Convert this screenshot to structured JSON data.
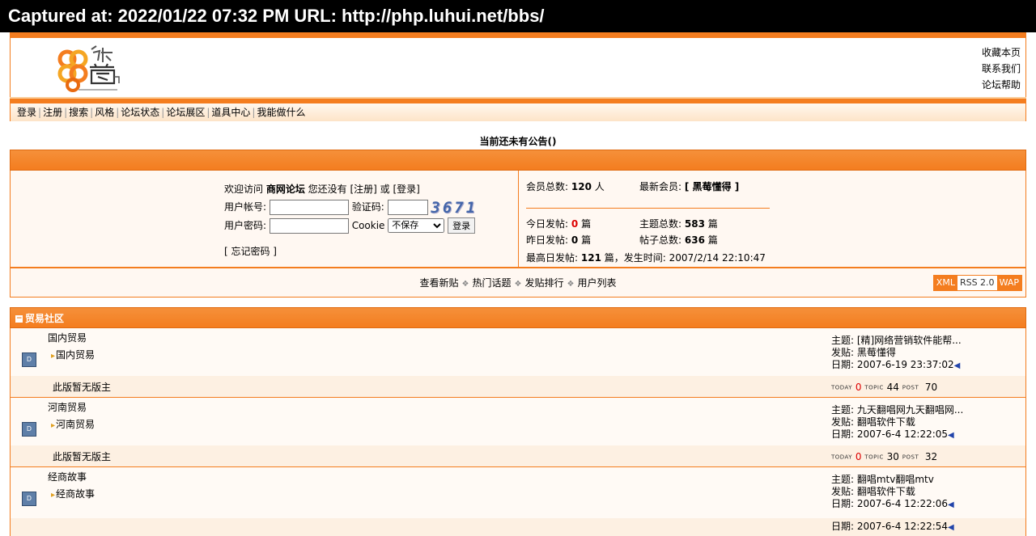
{
  "capture": {
    "label": "Captured at: 2022/01/22 07:32 PM    URL: http://php.luhui.net/bbs/"
  },
  "header": {
    "links": [
      "收藏本页",
      "联系我们",
      "论坛帮助"
    ]
  },
  "nav": {
    "items": [
      "登录",
      "注册",
      "搜索",
      "风格",
      "论坛状态",
      "论坛展区",
      "道具中心",
      "我能做什么"
    ]
  },
  "announcement": "当前还未有公告()",
  "login": {
    "welcome_pre": "欢迎访问 ",
    "forum_name": "商网论坛",
    "welcome_mid": " 您还没有 [注册] 或 [登录]",
    "account_label": "用户帐号:",
    "code_label": "验证码:",
    "captcha": "3671",
    "password_label": "用户密码:",
    "cookie_label": "Cookie",
    "cookie_option": "不保存",
    "login_button": "登录",
    "forgot": "[ 忘记密码 ]"
  },
  "stats": {
    "members_label": "会员总数:",
    "members_value": "120",
    "members_unit": "人",
    "newest_label": "最新会员:",
    "newest_value": "[ 黑莓懂得 ]",
    "today_label": "今日发帖:",
    "today_value": "0",
    "unit_pian": "篇",
    "topics_label": "主题总数:",
    "topics_value": "583",
    "yesterday_label": "昨日发帖:",
    "yesterday_value": "0",
    "posts_label": "帖子总数:",
    "posts_value": "636",
    "max_label": "最高日发帖:",
    "max_value": "121",
    "max_unit": "篇，发生时间:",
    "max_time": "2007/2/14 22:10:47"
  },
  "links_bar": {
    "items": [
      "查看新贴",
      "热门话题",
      "发贴排行",
      "用户列表"
    ],
    "badges": [
      "XML",
      "RSS 2.0",
      "WAP"
    ]
  },
  "section": {
    "title": "贸易社区"
  },
  "forums": [
    {
      "name": "国内贸易",
      "sub": "国内贸易",
      "mods": "此版暂无版主",
      "last_topic": "主题: [精]网络营销软件能帮...",
      "last_poster": "发贴: 黑莓懂得",
      "last_date": "日期: 2007-6-19 23:37:02",
      "today": "0",
      "topics": "44",
      "posts": "70"
    },
    {
      "name": "河南贸易",
      "sub": "河南贸易",
      "mods": "此版暂无版主",
      "last_topic": "主题: 九天翻唱网九天翻唱网...",
      "last_poster": "发贴: 翻唱软件下载",
      "last_date": "日期: 2007-6-4 12:22:05",
      "today": "0",
      "topics": "30",
      "posts": "32"
    },
    {
      "name": "经商故事",
      "sub": "经商故事",
      "mods": "",
      "last_topic": "主题: 翻唱mtv翻唱mtv",
      "last_poster": "发贴: 翻唱软件下载",
      "last_date": "日期: 2007-6-4 12:22:06",
      "today": "",
      "topics": "",
      "posts": ""
    }
  ],
  "forum_partial_date": "日期: 2007-6-4 12:22:54",
  "count_labels": {
    "today": "TODAY",
    "topic": "TOPIC",
    "post": "POST"
  },
  "colors": {
    "accent": "#f47d1f",
    "panel_bg": "#fff8f2",
    "stat_red": "#dd0000"
  }
}
